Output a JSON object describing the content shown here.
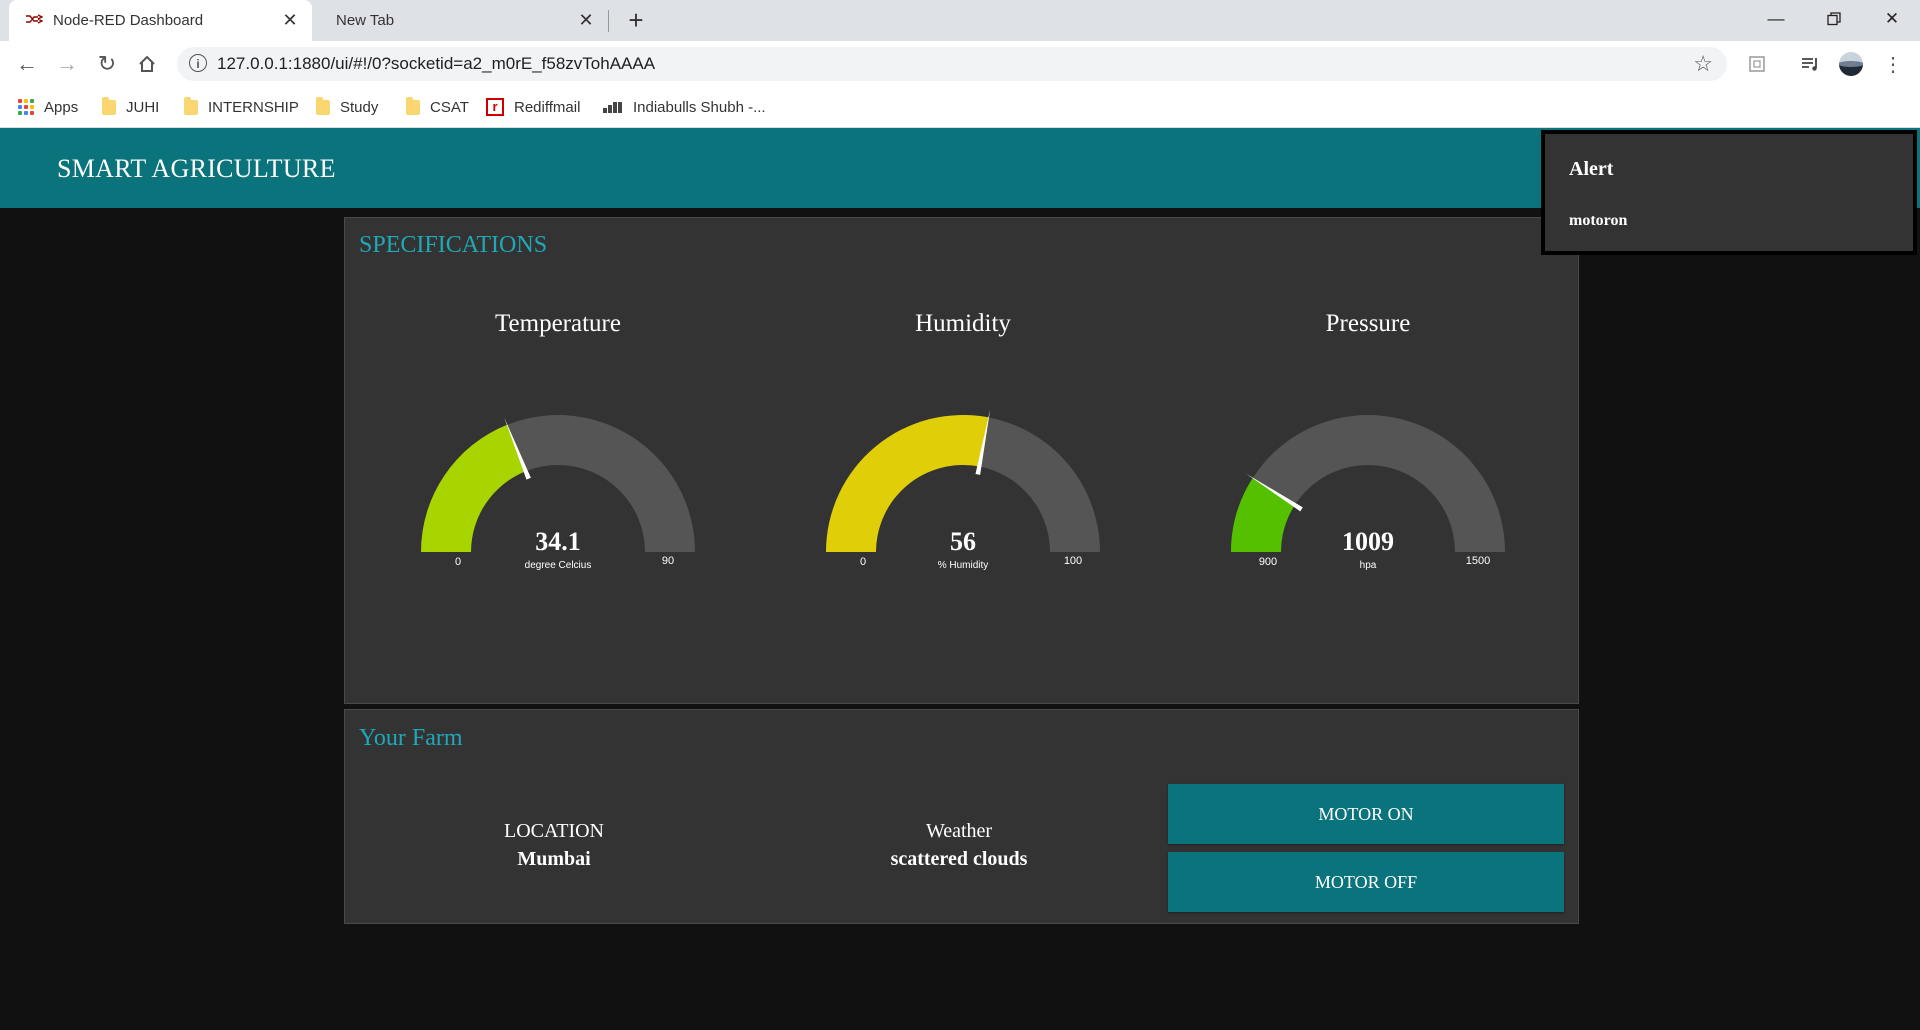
{
  "browser": {
    "tabs": [
      {
        "title": "Node-RED Dashboard",
        "active": true
      },
      {
        "title": "New Tab",
        "active": false
      }
    ],
    "url": "127.0.0.1:1880/ui/#!/0?socketid=a2_m0rE_f58zvTohAAAA",
    "bookmarks": [
      {
        "label": "Apps",
        "icon": "apps-grid-icon"
      },
      {
        "label": "JUHI",
        "icon": "folder-icon"
      },
      {
        "label": "INTERNSHIP",
        "icon": "folder-icon"
      },
      {
        "label": "Study",
        "icon": "folder-icon"
      },
      {
        "label": "CSAT",
        "icon": "folder-icon"
      },
      {
        "label": "Rediffmail",
        "icon": "rediff-icon"
      },
      {
        "label": "Indiabulls Shubh -...",
        "icon": "bars-icon"
      }
    ]
  },
  "dashboard": {
    "title": "SMART AGRICULTURE",
    "colors": {
      "header": "#0b737b",
      "group_title": "#1fa8b6",
      "background": "#111111",
      "group": "#333333"
    },
    "specifications": {
      "title": "SPECIFICATIONS",
      "gauges": [
        {
          "title": "Temperature",
          "value": 34.1,
          "display": "34.1",
          "unit": "degree Celcius",
          "min": 0,
          "max": 90,
          "min_label": "0",
          "max_label": "90",
          "color": "#a8d400"
        },
        {
          "title": "Humidity",
          "value": 56,
          "display": "56",
          "unit": "% Humidity",
          "min": 0,
          "max": 100,
          "min_label": "0",
          "max_label": "100",
          "color": "#e0cf08"
        },
        {
          "title": "Pressure",
          "value": 1009,
          "display": "1009",
          "unit": "hpa",
          "min": 900,
          "max": 1500,
          "min_label": "900",
          "max_label": "1500",
          "color": "#55c000"
        }
      ]
    },
    "farm": {
      "title": "Your Farm",
      "location_label": "LOCATION",
      "location_value": "Mumbai",
      "weather_label": "Weather",
      "weather_value": "scattered clouds",
      "motor_on_label": "MOTOR ON",
      "motor_off_label": "MOTOR OFF"
    }
  },
  "toast": {
    "title": "Alert",
    "message": "motoron"
  }
}
